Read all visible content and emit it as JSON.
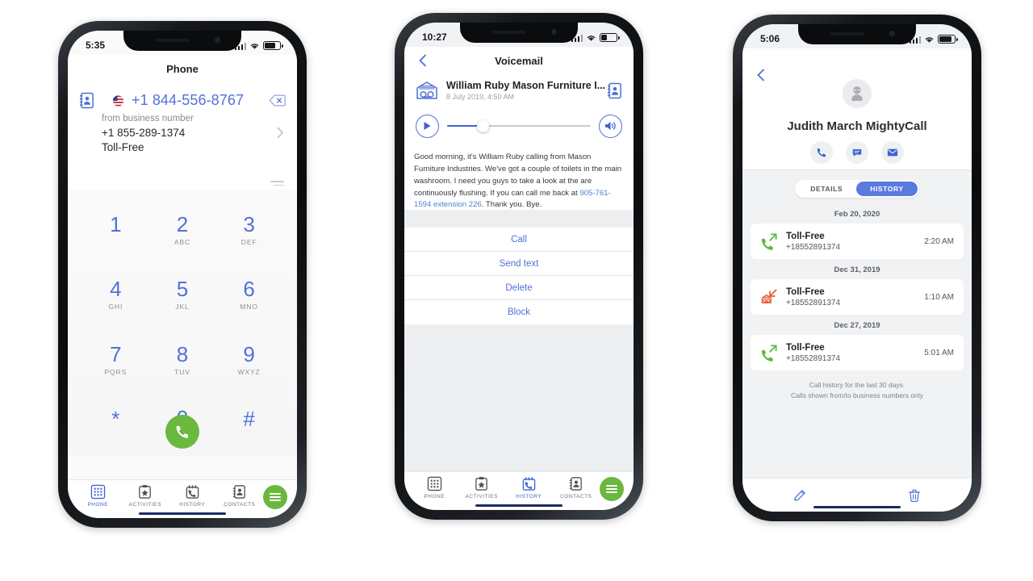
{
  "colors": {
    "accent_blue": "#5171d8",
    "nav_blue": "#3f63d4",
    "green": "#6ab83e",
    "red": "#e8603c",
    "segment_blue": "#5a7ae0",
    "text_dark": "#1d2024",
    "text_muted": "#868b90"
  },
  "phone1": {
    "status": {
      "time": "5:35"
    },
    "nav": {
      "title": "Phone"
    },
    "dialer": {
      "contacts_icon": "contact-book-icon",
      "flag_icon": "us-flag-icon",
      "number": "+1 844-556-8767",
      "backspace_icon": "backspace-icon",
      "from_label": "from business number",
      "from_number": "+1 855-289-1374",
      "from_type": "Toll-Free",
      "chevron_icon": "chevron-right-icon"
    },
    "keys": [
      {
        "digit": "1",
        "letters": ""
      },
      {
        "digit": "2",
        "letters": "ABC"
      },
      {
        "digit": "3",
        "letters": "DEF"
      },
      {
        "digit": "4",
        "letters": "GHI"
      },
      {
        "digit": "5",
        "letters": "JKL"
      },
      {
        "digit": "6",
        "letters": "MNO"
      },
      {
        "digit": "7",
        "letters": "PQRS"
      },
      {
        "digit": "8",
        "letters": "TUV"
      },
      {
        "digit": "9",
        "letters": "WXYZ"
      },
      {
        "digit": "*",
        "letters": ""
      },
      {
        "digit": "0",
        "letters": "+"
      },
      {
        "digit": "#",
        "letters": ""
      }
    ],
    "call_button": "call-button",
    "tabs": [
      {
        "label": "PHONE",
        "icon": "keypad-icon",
        "active": true
      },
      {
        "label": "ACTIVITIES",
        "icon": "clipboard-star-icon",
        "active": false
      },
      {
        "label": "HISTORY",
        "icon": "calendar-phone-icon",
        "active": false
      },
      {
        "label": "CONTACTS",
        "icon": "contact-book-icon",
        "active": false
      }
    ],
    "fab": "menu-fab"
  },
  "phone2": {
    "status": {
      "time": "10:27"
    },
    "nav": {
      "title": "Voicemail",
      "back_icon": "chevron-left-icon"
    },
    "voicemail": {
      "icon": "voicemail-icon",
      "title": "William Ruby Mason Furniture I...",
      "date": "8 July 2019, 4:50 AM",
      "contact_icon": "contact-book-icon",
      "play_icon": "play-icon",
      "volume_icon": "speaker-icon",
      "transcript_pre": "Good morning, it's William Ruby calling from Mason Furniture Industries. We've got a couple of toilets in the main washroom. I need you guys to take a look at the are continuously flushing. If you can call me back at ",
      "transcript_phone": "905-761-1594 extension 226",
      "transcript_post": ". Thank you. Bye."
    },
    "actions": [
      {
        "label": "Call"
      },
      {
        "label": "Send text"
      },
      {
        "label": "Delete"
      },
      {
        "label": "Block"
      }
    ],
    "tabs": [
      {
        "label": "PHONE",
        "icon": "keypad-icon",
        "active": false
      },
      {
        "label": "ACTIVITIES",
        "icon": "clipboard-star-icon",
        "active": false
      },
      {
        "label": "HISTORY",
        "icon": "calendar-phone-icon",
        "active": true
      },
      {
        "label": "CONTACTS",
        "icon": "contact-book-icon",
        "active": false
      }
    ],
    "fab": "menu-fab"
  },
  "phone3": {
    "status": {
      "time": "5:06"
    },
    "nav": {
      "back_icon": "chevron-left-icon"
    },
    "contact": {
      "avatar_icon": "avatar-placeholder-icon",
      "name": "Judith March MightyCall",
      "actions": [
        {
          "icon": "phone-icon",
          "name": "call-action"
        },
        {
          "icon": "message-icon",
          "name": "message-action"
        },
        {
          "icon": "mail-icon",
          "name": "email-action"
        }
      ]
    },
    "segments": [
      {
        "label": "DETAILS",
        "active": false
      },
      {
        "label": "HISTORY",
        "active": true
      }
    ],
    "history": [
      {
        "day": "Feb 20, 2020",
        "icon": "outgoing-call-icon",
        "direction": "outgoing",
        "name": "Toll-Free",
        "number": "+18552891374",
        "time": "2:20 AM"
      },
      {
        "day": "Dec 31, 2019",
        "icon": "missed-voicemail-icon",
        "direction": "missed",
        "name": "Toll-Free",
        "number": "+18552891374",
        "time": "1:10 AM"
      },
      {
        "day": "Dec 27, 2019",
        "icon": "outgoing-call-icon",
        "direction": "outgoing",
        "name": "Toll-Free",
        "number": "+18552891374",
        "time": "5:01 AM"
      }
    ],
    "footer_line1": "Call history for the last 30 days.",
    "footer_line2": "Calls shown from/to business numbers only",
    "bottom": {
      "edit_icon": "pencil-icon",
      "delete_icon": "trash-icon"
    }
  }
}
